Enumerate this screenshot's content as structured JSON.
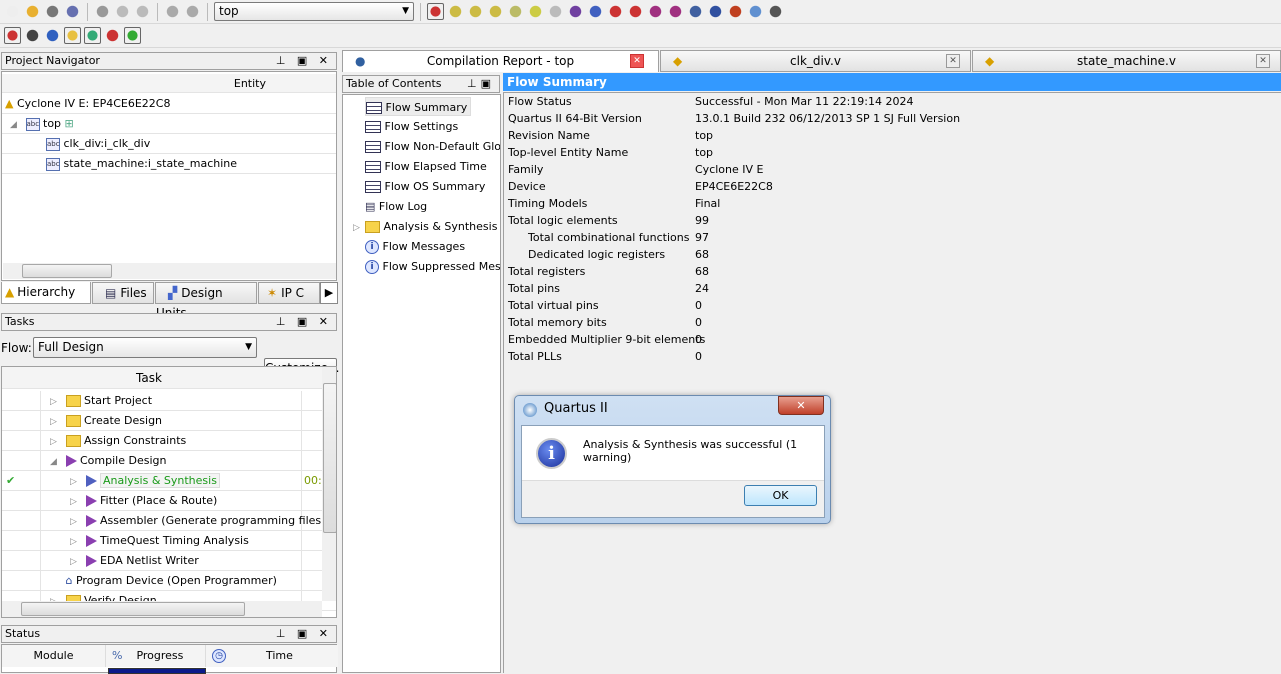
{
  "toolbar": {
    "revision_combo": "top",
    "icons_row1": [
      "new-file",
      "open",
      "save",
      "save-all",
      "cut",
      "copy",
      "paste",
      "undo",
      "redo",
      "chip-planner",
      "pin-planner",
      "assignment-editor",
      "settings",
      "compile-check",
      "analysis",
      "stop",
      "start-compilation",
      "start-analysis",
      "timequest",
      "timequest-alt",
      "rtl-viewer",
      "technology-viewer",
      "chip-editor",
      "programmer",
      "signaltap",
      "help",
      "whats-this"
    ],
    "icons_row2": [
      "netlist-navigator",
      "find",
      "edit",
      "toggle-1",
      "toggle-2",
      "refresh",
      "report-check"
    ]
  },
  "project_navigator": {
    "title": "Project Navigator",
    "column": "Entity",
    "device": "Cyclone IV E: EP4CE6E22C8",
    "items": [
      {
        "label": "top"
      },
      {
        "label": "clk_div:i_clk_div"
      },
      {
        "label": "state_machine:i_state_machine"
      }
    ],
    "tabs": [
      "Hierarchy",
      "Files",
      "Design Units",
      "IP C"
    ]
  },
  "tasks": {
    "title": "Tasks",
    "flow_label": "Flow:",
    "flow_value": "Full Design",
    "customize": "Customize...",
    "column": "Task",
    "items": [
      {
        "label": "Start Project"
      },
      {
        "label": "Create Design"
      },
      {
        "label": "Assign Constraints"
      },
      {
        "label": "Compile Design"
      },
      {
        "label": "Analysis & Synthesis",
        "time": "00:",
        "status": "success"
      },
      {
        "label": "Fitter (Place & Route)"
      },
      {
        "label": "Assembler (Generate programming files)"
      },
      {
        "label": "TimeQuest Timing Analysis"
      },
      {
        "label": "EDA Netlist Writer"
      },
      {
        "label": "Program Device (Open Programmer)"
      },
      {
        "label": "Verify Design"
      }
    ]
  },
  "status": {
    "title": "Status",
    "columns": [
      "Module",
      "%",
      "Progress",
      "Time"
    ]
  },
  "doc_tabs": [
    {
      "label": "Compilation Report - top",
      "active": true
    },
    {
      "label": "clk_div.v"
    },
    {
      "label": "state_machine.v"
    }
  ],
  "toc": {
    "title": "Table of Contents",
    "items": [
      "Flow Summary",
      "Flow Settings",
      "Flow Non-Default Global Settings",
      "Flow Elapsed Time",
      "Flow OS Summary",
      "Flow Log",
      "Analysis & Synthesis",
      "Flow Messages",
      "Flow Suppressed Messages"
    ]
  },
  "summary": {
    "title": "Flow Summary",
    "header_color": "#3399ff",
    "rows": [
      [
        "Flow Status",
        "Successful - Mon Mar 11 22:19:14 2024",
        false
      ],
      [
        "Quartus II 64-Bit Version",
        "13.0.1 Build 232 06/12/2013 SP 1 SJ Full Version",
        false
      ],
      [
        "Revision Name",
        "top",
        false
      ],
      [
        "Top-level Entity Name",
        "top",
        false
      ],
      [
        "Family",
        "Cyclone IV E",
        false
      ],
      [
        "Device",
        "EP4CE6E22C8",
        false
      ],
      [
        "Timing Models",
        "Final",
        false
      ],
      [
        "Total logic elements",
        "99",
        false
      ],
      [
        "Total combinational functions",
        "97",
        true
      ],
      [
        "Dedicated logic registers",
        "68",
        true
      ],
      [
        "Total registers",
        "68",
        false
      ],
      [
        "Total pins",
        "24",
        false
      ],
      [
        "Total virtual pins",
        "0",
        false
      ],
      [
        "Total memory bits",
        "0",
        false
      ],
      [
        "Embedded Multiplier 9-bit elements",
        "0",
        false
      ],
      [
        "Total PLLs",
        "0",
        false
      ]
    ]
  },
  "dialog": {
    "title": "Quartus II",
    "message": "Analysis & Synthesis was successful (1 warning)",
    "ok": "OK"
  }
}
